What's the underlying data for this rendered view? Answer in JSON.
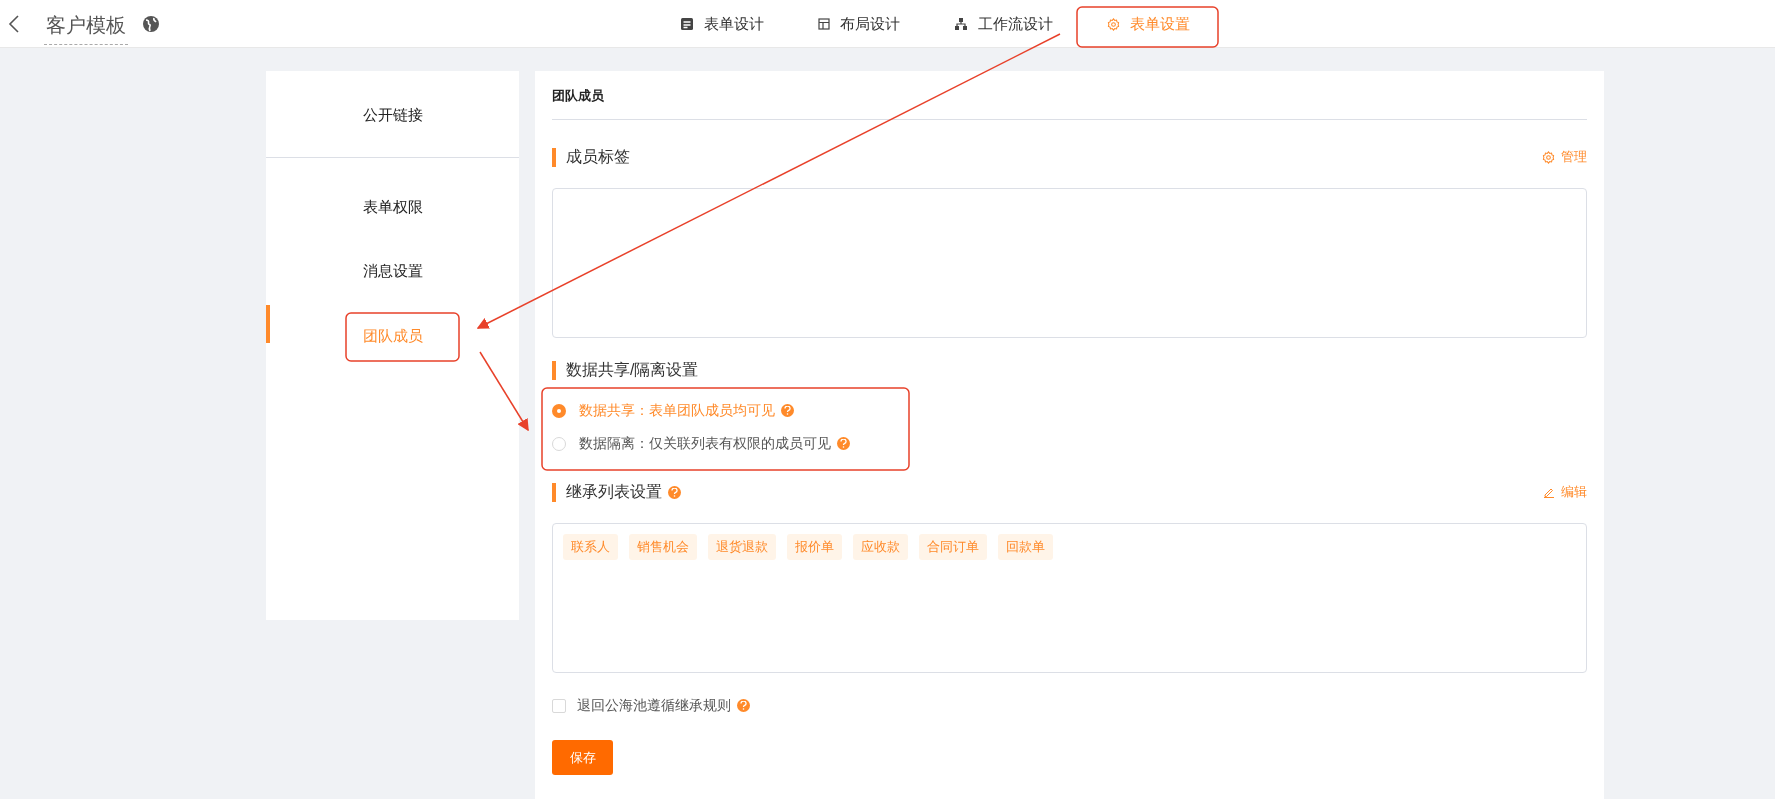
{
  "header": {
    "title": "客户模板",
    "tabs": [
      {
        "label": "表单设计",
        "kind": "form",
        "selected": false
      },
      {
        "label": "布局设计",
        "kind": "layout",
        "selected": false
      },
      {
        "label": "工作流设计",
        "kind": "flow",
        "selected": false
      },
      {
        "label": "表单设置",
        "kind": "gear",
        "selected": true
      }
    ]
  },
  "sidebar": {
    "groups": [
      {
        "items": [
          {
            "label": "公开链接",
            "selected": false
          }
        ]
      },
      {
        "items": [
          {
            "label": "表单权限",
            "selected": false
          },
          {
            "label": "消息设置",
            "selected": false
          },
          {
            "label": "团队成员",
            "selected": true
          }
        ]
      }
    ]
  },
  "panel": {
    "title": "团队成员",
    "member_tags": {
      "title": "成员标签",
      "action": "管理"
    },
    "data_mode": {
      "title": "数据共享/隔离设置",
      "options": [
        {
          "label": "数据共享：表单团队成员均可见",
          "selected": true
        },
        {
          "label": "数据隔离：仅关联列表有权限的成员可见",
          "selected": false
        }
      ]
    },
    "inherit": {
      "title": "继承列表设置",
      "action": "编辑",
      "tags": [
        "联系人",
        "销售机会",
        "退货退款",
        "报价单",
        "应收款",
        "合同订单",
        "回款单"
      ]
    },
    "return_rule": {
      "label": "退回公海池遵循继承规则",
      "checked": false
    },
    "save": "保存"
  }
}
